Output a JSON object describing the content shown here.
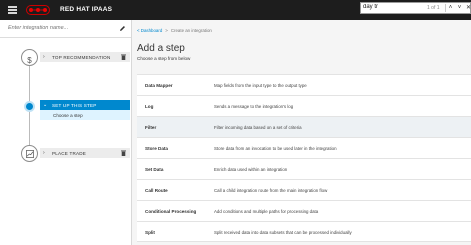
{
  "header": {
    "brand": "RED HAT IPAAS"
  },
  "find_bar": {
    "query": "day tr",
    "count": "1 of 1"
  },
  "sidebar": {
    "name_placeholder": "Enter integration name...",
    "steps": [
      {
        "label": "TOP RECOMMENDATION",
        "symbol": "$"
      },
      {
        "label": "SET UP THIS STEP",
        "sub_label": "Choose a step"
      },
      {
        "label": "PLACE TRADE"
      }
    ]
  },
  "main": {
    "breadcrumb": {
      "home": "< Dashboard",
      "current": "Create an integration"
    },
    "title": "Add a step",
    "subtitle": "Choose a step from below",
    "steps": [
      {
        "name": "Data Mapper",
        "description": "Map fields from the input type to the output type"
      },
      {
        "name": "Log",
        "description": "Sends a message to the integration's log"
      },
      {
        "name": "Filter",
        "description": "Filter incoming data based on a set of criteria",
        "highlighted": true
      },
      {
        "name": "Store Data",
        "description": "Store data from an invocation to be used later in the integration"
      },
      {
        "name": "Set Data",
        "description": "Enrich data used within an integration"
      },
      {
        "name": "Call Route",
        "description": "Call a child integration route from the main integration flow"
      },
      {
        "name": "Conditional Processing",
        "description": "Add conditions and multiple paths for processing data"
      },
      {
        "name": "Split",
        "description": "Split received data into data subsets that can be processed individually"
      }
    ]
  }
}
